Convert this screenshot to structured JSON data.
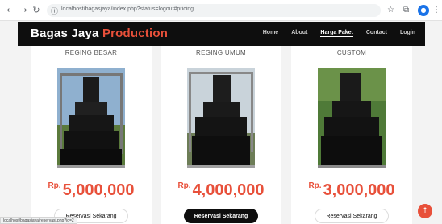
{
  "browser": {
    "url": "localhost/bagasjaya/index.php?status=logout#pricing",
    "status_url": "localhost/bagasjaya/reservasi.php?id=2"
  },
  "site": {
    "brand_part1": "Bagas Jaya",
    "brand_part2": "Production",
    "accent_color": "#e8503a",
    "nav": [
      "Home",
      "About",
      "Harga Paket",
      "Contact",
      "Login"
    ],
    "active_nav": "Harga Paket"
  },
  "packages": [
    {
      "title": "REGING BESAR",
      "currency": "Rp.",
      "price": "5,000,000",
      "button": "Reservasi Sekarang"
    },
    {
      "title": "REGING UMUM",
      "currency": "Rp.",
      "price": "4,000,000",
      "button": "Reservasi Sekarang"
    },
    {
      "title": "CUSTOM",
      "currency": "Rp.",
      "price": "3,000,000",
      "button": "Reservasi Sekarang"
    }
  ]
}
